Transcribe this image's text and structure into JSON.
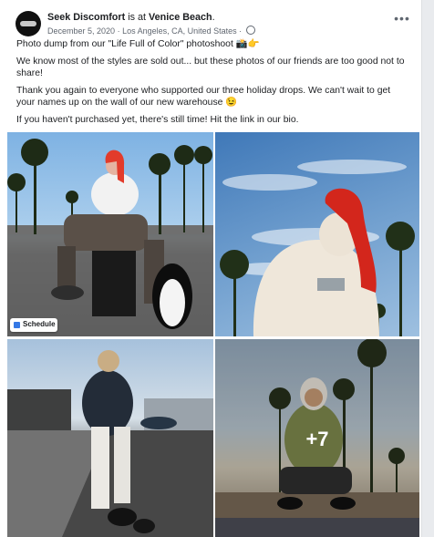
{
  "post": {
    "page_name": "Seek Discomfort",
    "checkin_text": "is at",
    "place": "Venice Beach",
    "place_suffix": ".",
    "date": "December 5, 2020",
    "separator": "·",
    "location": "Los Angeles, CA, United States",
    "privacy_separator": "·",
    "text": [
      "Photo dump from our \"Life Full of Color\" photoshoot 📸👉",
      "We know most of the styles are sold out... but these photos of our friends are too good not to share!",
      "Thank you again to everyone who supported our three holiday drops. We can't wait to get your names up on the wall of our new warehouse 😉",
      "If you haven't purchased yet, there's still time! Hit the link in our bio."
    ]
  },
  "icons": {
    "avatar": "seek-discomfort-logo",
    "privacy": "globe-icon",
    "more": "more-options-icon",
    "schedule": "schedule-icon"
  },
  "photos": {
    "more_count": "+7",
    "schedule_label": "Schedule"
  },
  "colors": {
    "text": "#1c1e21",
    "meta": "#606770",
    "schedule_accent": "#3578e5"
  }
}
